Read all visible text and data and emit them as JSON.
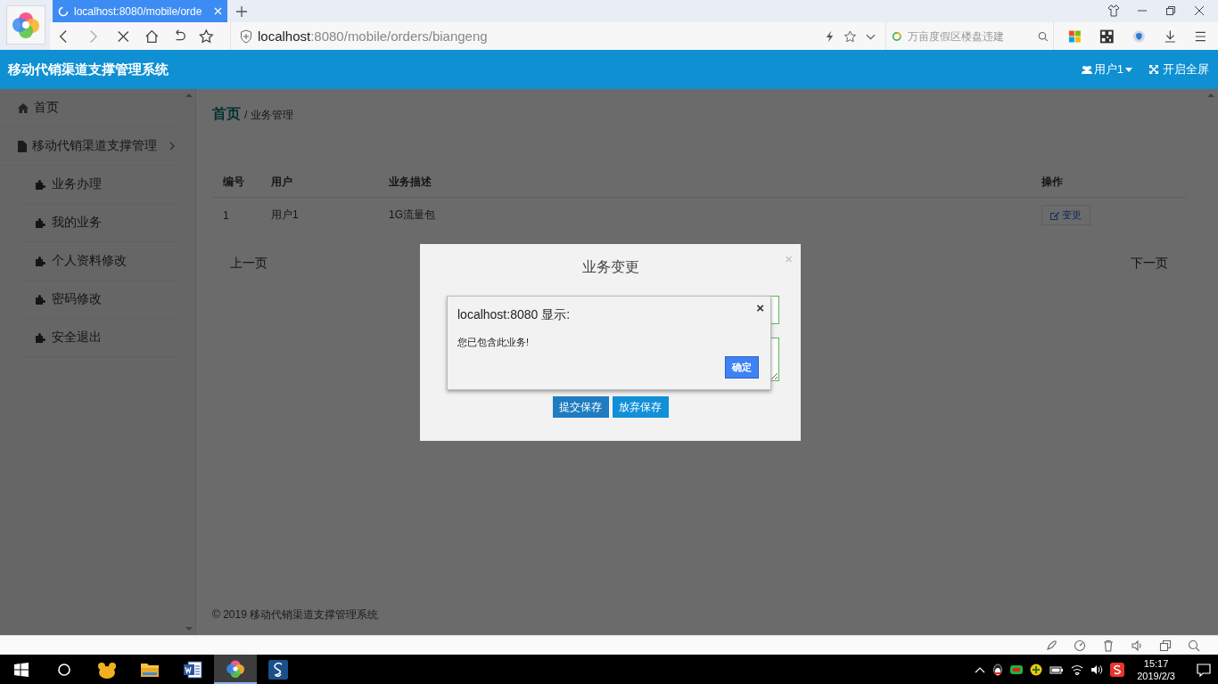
{
  "browser": {
    "tab": {
      "title": "localhost:8080/mobile/orde",
      "loading": true
    },
    "address": {
      "host": "localhost",
      "rest": ":8080/mobile/orders/biangeng"
    },
    "search": {
      "placeholder": "万亩度假区楼盘违建"
    }
  },
  "app": {
    "title": "移动代销渠道支撑管理系统",
    "user_menu": "用户1",
    "fullscreen": "开启全屏"
  },
  "sidebar": {
    "items": [
      {
        "label": "首页",
        "kind": "home"
      },
      {
        "label": "移动代销渠道支撑管理",
        "kind": "file",
        "children": [
          {
            "label": "业务办理",
            "kind": "puzzle"
          },
          {
            "label": "我的业务",
            "kind": "puzzle"
          },
          {
            "label": "个人资料修改",
            "kind": "puzzle"
          },
          {
            "label": "密码修改",
            "kind": "puzzle"
          },
          {
            "label": "安全退出",
            "kind": "puzzle"
          }
        ]
      }
    ]
  },
  "breadcrumb": {
    "home": "首页",
    "separator": "/",
    "current": "业务管理"
  },
  "table": {
    "columns": [
      "编号",
      "用户",
      "业务描述",
      "操作"
    ],
    "rows": [
      {
        "cells": [
          "1",
          "用户1",
          "1G流量包"
        ],
        "action": "变更"
      }
    ]
  },
  "pager": {
    "prev": "上一页",
    "next": "下一页"
  },
  "footer": "© 2019 移动代销渠道支撑管理系统",
  "modal": {
    "title": "业务变更",
    "close": "×",
    "buttons": [
      "提交保存",
      "放弃保存"
    ]
  },
  "alert": {
    "title": "localhost:8080 显示:",
    "message": "您已包含此业务!",
    "close": "×",
    "ok": "确定"
  },
  "taskbar": {
    "apps": [
      {
        "kind": "bear",
        "selected": false
      },
      {
        "kind": "folder",
        "selected": false
      },
      {
        "kind": "word",
        "selected": false
      },
      {
        "kind": "browser",
        "selected": true
      },
      {
        "kind": "eight",
        "selected": false
      }
    ],
    "time": "15:17",
    "date": "2019/2/3"
  }
}
